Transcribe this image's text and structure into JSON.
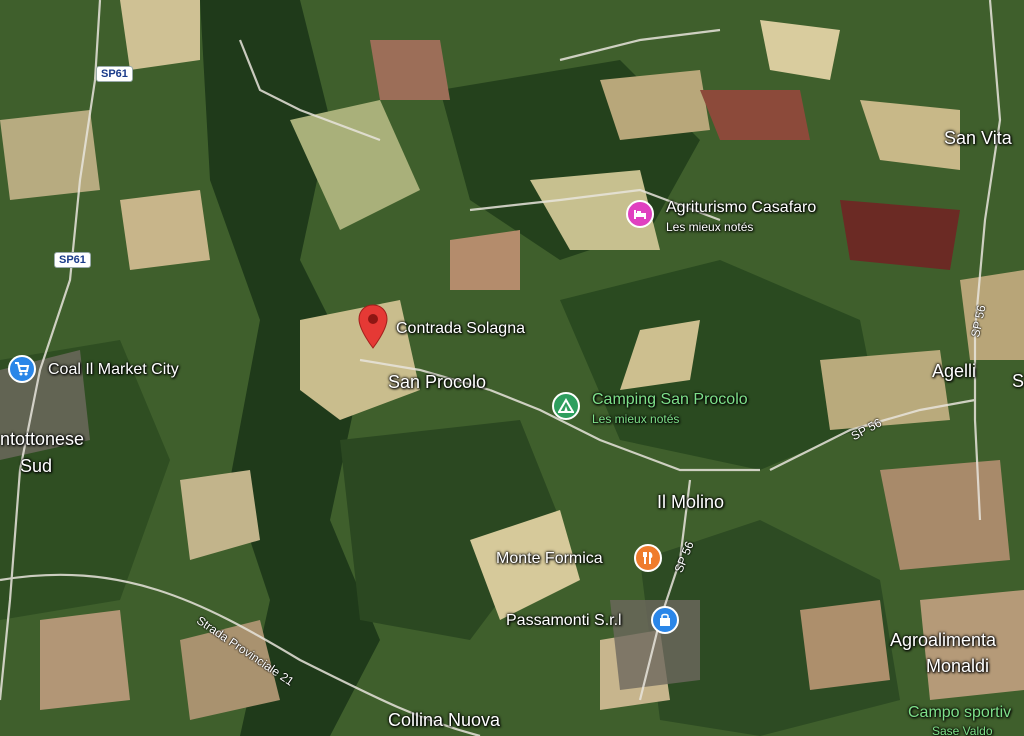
{
  "colors": {
    "lodging": "#e040c0",
    "camping": "#2e9e5e",
    "food": "#ef7c2c",
    "shopping": "#2a86e8",
    "marker": "#e53935"
  },
  "places": {
    "san_vita": "San Vita",
    "agriturismo": "Agriturismo Casafaro",
    "agriturismo_sub": "Les mieux notés",
    "contrada": "Contrada Solagna",
    "san_procolo": "San Procolo",
    "coal": "Coal Il Market City",
    "agelli": "Agelli",
    "camping": "Camping San Procolo",
    "camping_sub": "Les mieux notés",
    "pontottonese_1": "ntottonese",
    "pontottonese_2": "Sud",
    "il_molino": "Il Molino",
    "monte_formica": "Monte Formica",
    "passamonti": "Passamonti S.r.l",
    "agroalimentare_1": "Agroalimenta",
    "agroalimentare_2": "Monaldi",
    "campo_1": "Campo sportiv",
    "campo_2": "Sase Valdo",
    "collina_nuova": "Collina Nuova",
    "edge_s": "S"
  },
  "roads": {
    "sp61_top": "SP61",
    "sp61_mid": "SP61",
    "sp56_right": "SP 56",
    "sp56_mid": "SP 56",
    "sp56_lower": "SP 56",
    "strada": "Strada Provinciale 21"
  },
  "icons": {
    "lodging": "bed-icon",
    "camping": "tent-icon",
    "food": "fork-knife-icon",
    "shopping_bag": "shopping-bag-icon",
    "cart": "shopping-cart-icon",
    "marker": "location-pin-icon"
  }
}
